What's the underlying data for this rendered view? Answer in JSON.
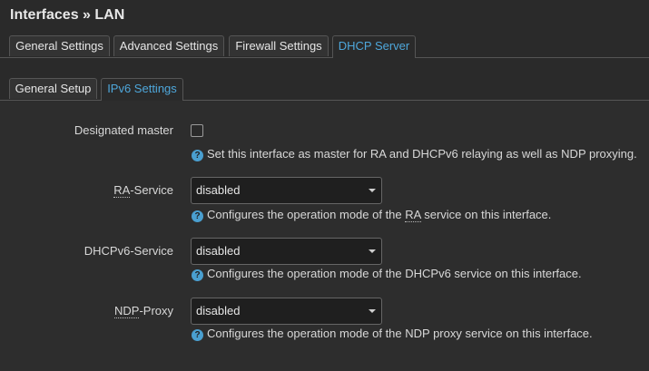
{
  "page": {
    "title": "Interfaces » LAN"
  },
  "tabs": [
    {
      "label": "General Settings"
    },
    {
      "label": "Advanced Settings"
    },
    {
      "label": "Firewall Settings"
    },
    {
      "label": "DHCP Server"
    }
  ],
  "subtabs": [
    {
      "label": "General Setup"
    },
    {
      "label": "IPv6 Settings"
    }
  ],
  "fields": {
    "designated_master": {
      "label": "Designated master",
      "checked": false,
      "help": "Set this interface as master for RA and DHCPv6 relaying as well as NDP proxying."
    },
    "ra_service": {
      "label_abbr": "RA",
      "label_rest": "-Service",
      "value": "disabled",
      "help_pre": "Configures the operation mode of the ",
      "help_abbr": "RA",
      "help_post": " service on this interface."
    },
    "dhcpv6_service": {
      "label": "DHCPv6-Service",
      "value": "disabled",
      "help": "Configures the operation mode of the DHCPv6 service on this interface."
    },
    "ndp_proxy": {
      "label_abbr": "NDP",
      "label_rest": "-Proxy",
      "value": "disabled",
      "help": "Configures the operation mode of the NDP proxy service on this interface."
    }
  },
  "colors": {
    "accent": "#4ea7db",
    "background": "#2a2a2a"
  }
}
